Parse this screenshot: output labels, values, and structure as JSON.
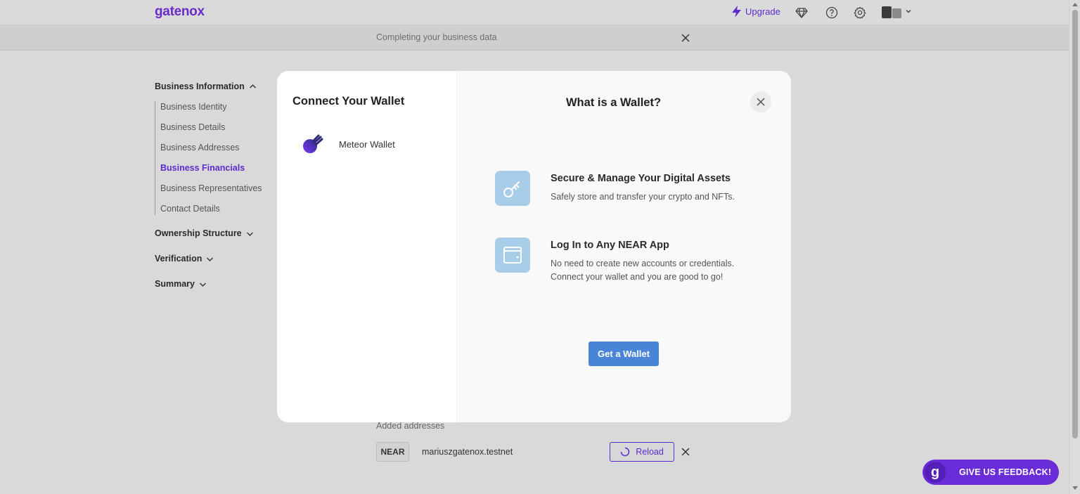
{
  "header": {
    "logo": "gatenox",
    "upgrade_label": "Upgrade"
  },
  "notice": {
    "text": "Completing your business data"
  },
  "sidebar": {
    "sections": [
      {
        "label": "Business Information",
        "expanded": true
      },
      {
        "label": "Ownership Structure",
        "expanded": false
      },
      {
        "label": "Verification",
        "expanded": false
      },
      {
        "label": "Summary",
        "expanded": false
      }
    ],
    "items": [
      {
        "label": "Business Identity"
      },
      {
        "label": "Business Details"
      },
      {
        "label": "Business Addresses"
      },
      {
        "label": "Business Financials",
        "active": true
      },
      {
        "label": "Business Representatives"
      },
      {
        "label": "Contact Details"
      }
    ]
  },
  "addresses": {
    "label": "Added addresses",
    "network": "NEAR",
    "address": "mariuszgatenox.testnet",
    "reload_label": "Reload"
  },
  "feedback": {
    "label": "GIVE US FEEDBACK!",
    "badge": "g"
  },
  "modal": {
    "title": "Connect Your Wallet",
    "wallets": [
      {
        "name": "Meteor Wallet",
        "icon": "meteor-wallet-icon"
      }
    ],
    "right_title": "What is a Wallet?",
    "features": [
      {
        "title": "Secure & Manage Your Digital Assets",
        "desc": "Safely store and transfer your crypto and NFTs.",
        "icon": "key-icon"
      },
      {
        "title": "Log In to Any NEAR App",
        "desc_line1": "No need to create new accounts or credentials.",
        "desc_line2": "Connect your wallet and you are good to go!",
        "icon": "wallet-icon"
      }
    ],
    "cta_label": "Get a Wallet"
  },
  "colors": {
    "brand": "#6a2bc7",
    "accent_blue": "#4a84d6",
    "feature_icon_bg": "#a8cde8",
    "feedback_bg": "#6a2bd9"
  }
}
